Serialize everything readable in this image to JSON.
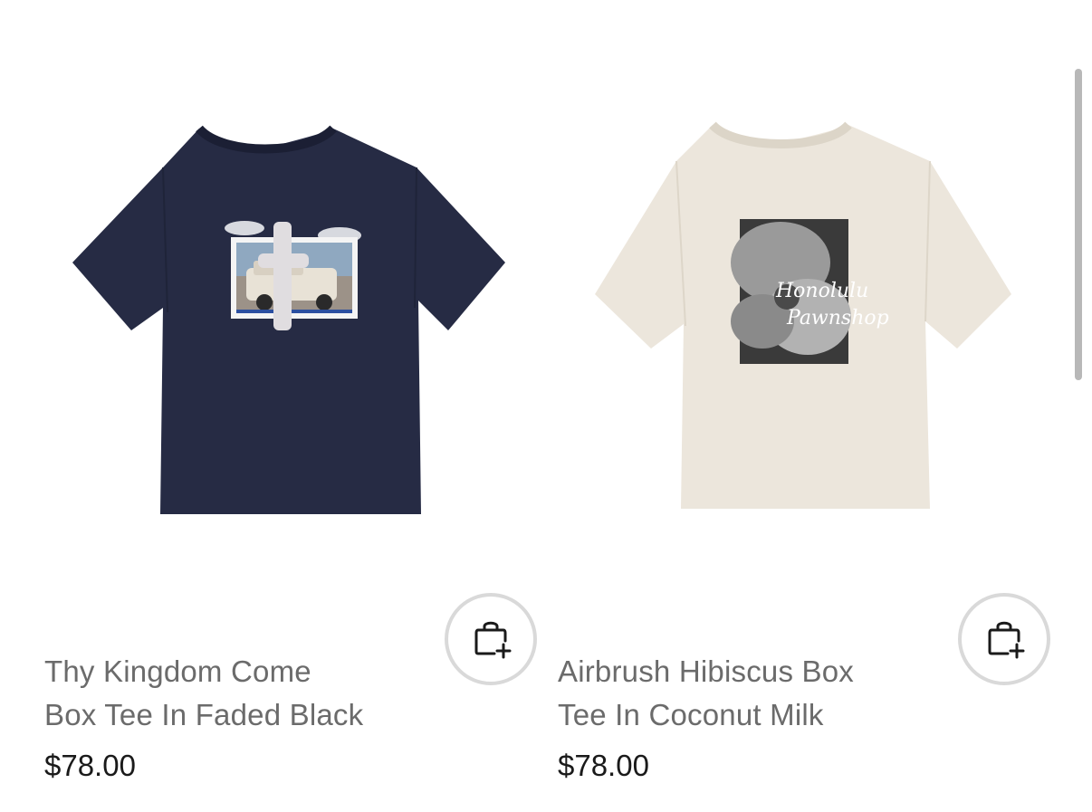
{
  "products": [
    {
      "title_line1": "Thy Kingdom Come",
      "title_line2": "Box Tee In Faded Black",
      "price": "$78.00",
      "shirt_color": "#262b44",
      "add_to_bag_icon": "bag-plus-icon",
      "graphic": "car photo print"
    },
    {
      "title_line1": "Airbrush Hibiscus Box",
      "title_line2": "Tee In Coconut Milk",
      "price": "$78.00",
      "shirt_color": "#ece6dc",
      "add_to_bag_icon": "bag-plus-icon",
      "graphic": "hibiscus photo print",
      "graphic_text_line1": "Honolulu",
      "graphic_text_line2": "Pawnshop"
    }
  ]
}
